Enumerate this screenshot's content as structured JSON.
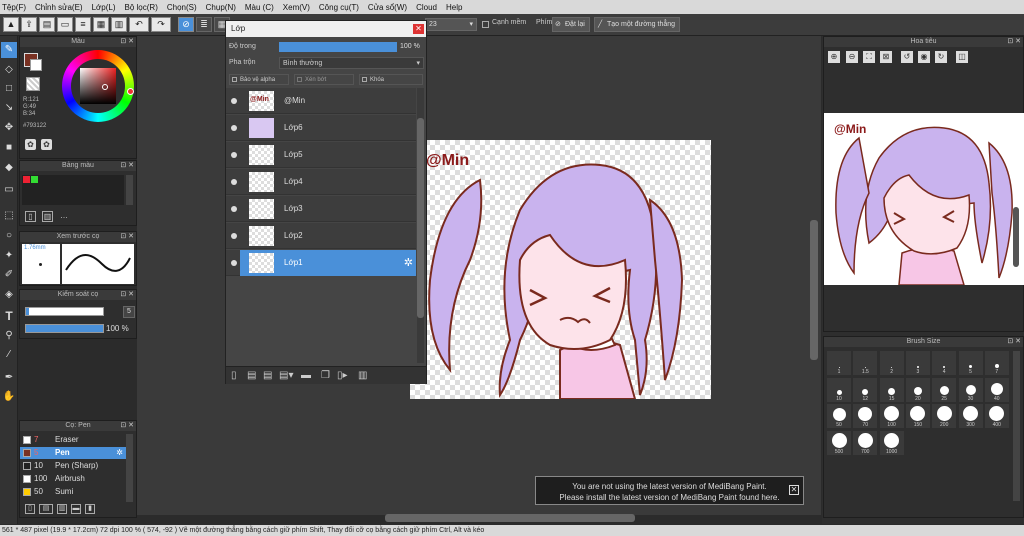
{
  "menu": [
    "Tệp(F)",
    "Chỉnh sửa(E)",
    "Lớp(L)",
    "Bộ lọc(R)",
    "Chọn(S)",
    "Chụp(N)",
    "Màu (C)",
    "Xem(V)",
    "Công cụ(T)",
    "Cửa sổ(W)",
    "Cloud",
    "Help"
  ],
  "toolbar": {
    "size_value": "23",
    "snap_label": "Cạnh mềm",
    "phim_label": "Phím",
    "off_label": "Đặt lại",
    "line_label": "Tạo một đường thẳng"
  },
  "color_panel": {
    "title": "Màu",
    "r": "R:121",
    "g": "G:49",
    "b": "B:34",
    "hex": "#793122",
    "main_color": "#793122"
  },
  "palette_panel": {
    "title": "Bảng màu"
  },
  "preview_panel": {
    "title": "Xem trước cọ",
    "size": "1.76mm"
  },
  "control_panel": {
    "title": "Kiểm soát cọ",
    "size_value": "5",
    "opacity_value": "100 %"
  },
  "brush_panel": {
    "title": "Cọ: Pen",
    "items": [
      {
        "size": "7",
        "name": "Eraser",
        "color": "#ffffff"
      },
      {
        "size": "5",
        "name": "Pen",
        "color": "#793122",
        "selected": true
      },
      {
        "size": "10",
        "name": "Pen (Sharp)",
        "color": "#222222"
      },
      {
        "size": "100",
        "name": "Airbrush",
        "color": "#ffffff"
      },
      {
        "size": "50",
        "name": "Sumi",
        "color": "#ffcc00"
      }
    ]
  },
  "layer_window": {
    "title": "Lớp",
    "opacity_label": "Độ trong",
    "opacity_value": "100 %",
    "blend_label": "Pha trộn",
    "blend_value": "Bình thường",
    "protect_alpha": "Bảo vệ alpha",
    "clipping": "Xén bớt",
    "lock": "Khóa",
    "layers": [
      "@Min",
      "Lớp6",
      "Lớp5",
      "Lớp4",
      "Lớp3",
      "Lớp2",
      "Lớp1"
    ],
    "selected_layer": "Lớp1"
  },
  "navigator": {
    "title": "Hoa tiêu"
  },
  "brush_size": {
    "title": "Brush Size",
    "sizes": [
      "1",
      "1.5",
      "2",
      "3",
      "4",
      "5",
      "7",
      "10",
      "12",
      "15",
      "20",
      "25",
      "30",
      "40",
      "50",
      "70",
      "100",
      "150",
      "200",
      "300",
      "400",
      "500",
      "700",
      "1000"
    ]
  },
  "canvas": {
    "watermark": "@Min"
  },
  "notice": {
    "line1": "You are not using the latest version of MediBang Paint.",
    "line2": "Please install the latest version of MediBang Paint found here."
  },
  "status": "561 * 487 pixel   (19.9 * 17.2cm)   72 dpi   100 %   ( 574, -92 )   Vẽ một đường thẳng bằng cách giữ phím Shift, Thay đổi cỡ cọ bằng cách giữ phím Ctrl, Alt và kéo"
}
